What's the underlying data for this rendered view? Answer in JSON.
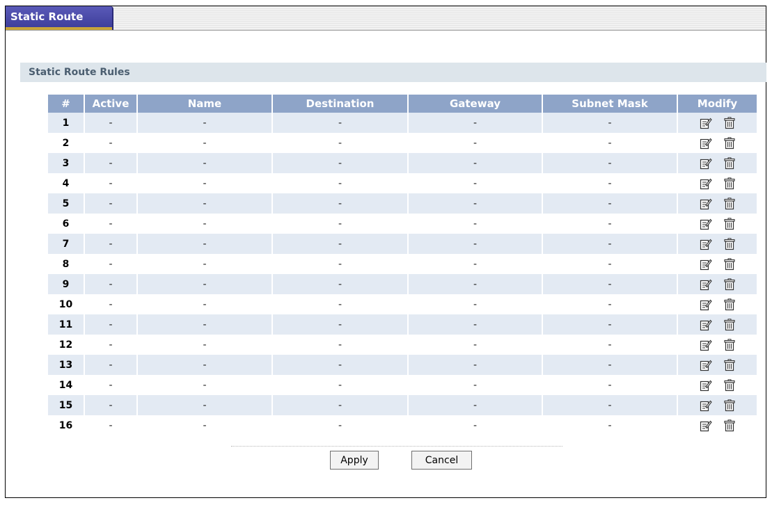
{
  "tabs": [
    {
      "label": "Static Route",
      "active": true
    }
  ],
  "section": {
    "title": "Static Route Rules"
  },
  "table": {
    "headers": [
      "#",
      "Active",
      "Name",
      "Destination",
      "Gateway",
      "Subnet Mask",
      "Modify"
    ],
    "rows": [
      {
        "num": "1",
        "active": "-",
        "name": "-",
        "destination": "-",
        "gateway": "-",
        "subnet_mask": "-"
      },
      {
        "num": "2",
        "active": "-",
        "name": "-",
        "destination": "-",
        "gateway": "-",
        "subnet_mask": "-"
      },
      {
        "num": "3",
        "active": "-",
        "name": "-",
        "destination": "-",
        "gateway": "-",
        "subnet_mask": "-"
      },
      {
        "num": "4",
        "active": "-",
        "name": "-",
        "destination": "-",
        "gateway": "-",
        "subnet_mask": "-"
      },
      {
        "num": "5",
        "active": "-",
        "name": "-",
        "destination": "-",
        "gateway": "-",
        "subnet_mask": "-"
      },
      {
        "num": "6",
        "active": "-",
        "name": "-",
        "destination": "-",
        "gateway": "-",
        "subnet_mask": "-"
      },
      {
        "num": "7",
        "active": "-",
        "name": "-",
        "destination": "-",
        "gateway": "-",
        "subnet_mask": "-"
      },
      {
        "num": "8",
        "active": "-",
        "name": "-",
        "destination": "-",
        "gateway": "-",
        "subnet_mask": "-"
      },
      {
        "num": "9",
        "active": "-",
        "name": "-",
        "destination": "-",
        "gateway": "-",
        "subnet_mask": "-"
      },
      {
        "num": "10",
        "active": "-",
        "name": "-",
        "destination": "-",
        "gateway": "-",
        "subnet_mask": "-"
      },
      {
        "num": "11",
        "active": "-",
        "name": "-",
        "destination": "-",
        "gateway": "-",
        "subnet_mask": "-"
      },
      {
        "num": "12",
        "active": "-",
        "name": "-",
        "destination": "-",
        "gateway": "-",
        "subnet_mask": "-"
      },
      {
        "num": "13",
        "active": "-",
        "name": "-",
        "destination": "-",
        "gateway": "-",
        "subnet_mask": "-"
      },
      {
        "num": "14",
        "active": "-",
        "name": "-",
        "destination": "-",
        "gateway": "-",
        "subnet_mask": "-"
      },
      {
        "num": "15",
        "active": "-",
        "name": "-",
        "destination": "-",
        "gateway": "-",
        "subnet_mask": "-"
      },
      {
        "num": "16",
        "active": "-",
        "name": "-",
        "destination": "-",
        "gateway": "-",
        "subnet_mask": "-"
      }
    ],
    "modify_icons": [
      "edit-icon",
      "delete-icon"
    ]
  },
  "buttons": {
    "apply": "Apply",
    "cancel": "Cancel"
  },
  "colors": {
    "tab_active": "#3b3b98",
    "header_bg": "#8ea4c8",
    "row_stripe": "#e3eaf3",
    "section_bg": "#dde5eb"
  }
}
